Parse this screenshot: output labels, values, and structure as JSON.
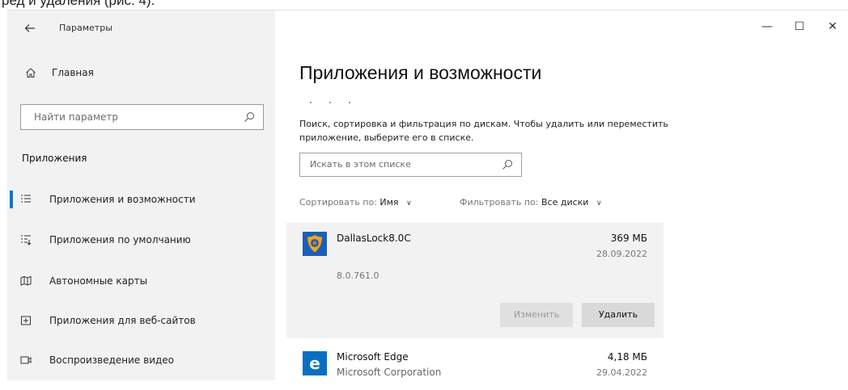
{
  "caption": {
    "text": "ред и удаления (рис. 4)."
  },
  "window": {
    "title": "Параметры",
    "controls": {
      "minimize": "—",
      "maximize": "☐",
      "close": "✕"
    }
  },
  "sidebar": {
    "home_label": "Главная",
    "search_placeholder": "Найти параметр",
    "section_title": "Приложения",
    "items": [
      {
        "label": "Приложения и возможности",
        "icon": "apps-features-icon",
        "active": true
      },
      {
        "label": "Приложения по умолчанию",
        "icon": "default-apps-icon",
        "active": false
      },
      {
        "label": "Автономные карты",
        "icon": "offline-maps-icon",
        "active": false
      },
      {
        "label": "Приложения для веб-сайтов",
        "icon": "apps-for-websites-icon",
        "active": false
      },
      {
        "label": "Воспроизведение видео",
        "icon": "video-playback-icon",
        "active": false
      }
    ]
  },
  "main": {
    "title": "Приложения и возможности",
    "description": "Поиск, сортировка и фильтрация по дискам. Чтобы удалить или переместить приложение, выберите его в списке.",
    "list_search_placeholder": "Искать в этом списке",
    "sort": {
      "label": "Сортировать по:",
      "value": "Имя"
    },
    "filter": {
      "label": "Фильтровать по:",
      "value": "Все диски"
    },
    "apps": [
      {
        "name": "DallasLock8.0C",
        "size": "369 МБ",
        "date": "28.09.2022",
        "version": "8.0.761.0",
        "icon": "dallaslock-shield-icon",
        "modify_label": "Изменить",
        "uninstall_label": "Удалить",
        "selected": true
      },
      {
        "name": "Microsoft Edge",
        "publisher": "Microsoft Corporation",
        "size": "4,18 МБ",
        "date": "29.04.2022",
        "icon": "edge-icon"
      }
    ]
  },
  "colors": {
    "accent": "#0078d7",
    "sidebar_bg": "#f2f2f2",
    "card_bg": "#f2f2f2",
    "edge_blue": "#0a6fc2"
  }
}
